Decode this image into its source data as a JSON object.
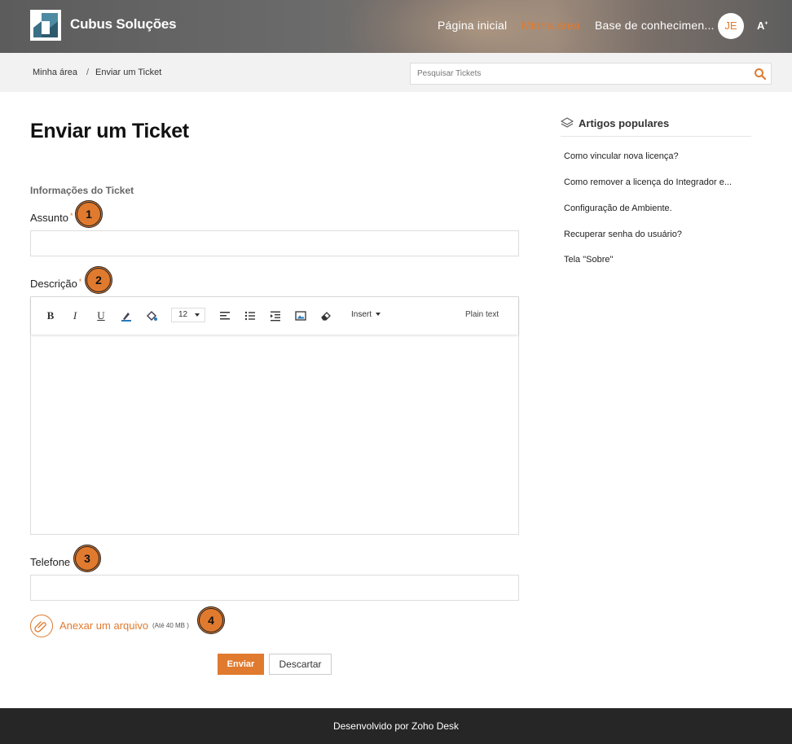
{
  "header": {
    "brand": "Cubus Soluções",
    "nav": [
      "Página inicial",
      "Minha área",
      "Base de conhecimen..."
    ],
    "avatar_initials": "JE",
    "accessibility_label": "A",
    "accent_color": "#e07a2e"
  },
  "breadcrumb": {
    "items": [
      "Minha área",
      "Enviar um Ticket"
    ],
    "separator": "/"
  },
  "search": {
    "placeholder": "Pesquisar Tickets",
    "icon": "search-icon"
  },
  "main": {
    "title": "Enviar um Ticket",
    "section_title": "Informações do Ticket",
    "subject_label": "Assunto",
    "description_label": "Descrição",
    "required_mark": "*",
    "phone_label": "Telefone",
    "toolbar": {
      "font_size": "12",
      "insert_label": "Insert",
      "plain_text_label": "Plain text",
      "icons": [
        "bold-icon",
        "italic-icon",
        "underline-icon",
        "text-color-icon",
        "background-color-icon",
        "align-left-icon",
        "bullet-list-icon",
        "indent-icon",
        "image-icon",
        "eraser-icon"
      ]
    },
    "attach_label": "Anexar um arquivo",
    "attach_note": "(Até 40 MB )",
    "submit_label": "Enviar",
    "discard_label": "Descartar"
  },
  "markers": [
    "1",
    "2",
    "3",
    "4"
  ],
  "sidebar": {
    "title": "Artigos populares",
    "articles": [
      "Como vincular nova licença?",
      "Como remover a licença do Integrador e...",
      "Configuração de Ambiente.",
      "Recuperar senha do usuário?",
      "Tela \"Sobre\""
    ]
  },
  "footer": {
    "text": "Desenvolvido por Zoho Desk"
  }
}
